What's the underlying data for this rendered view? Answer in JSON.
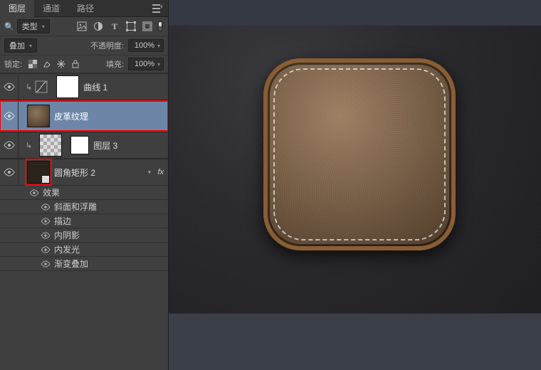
{
  "tabs": {
    "layers": "图层",
    "channels": "通道",
    "paths": "路径"
  },
  "filter_row": {
    "kind_label": "类型",
    "icons": [
      "image-filter-icon",
      "adjust-filter-icon",
      "type-filter-icon",
      "shape-filter-icon",
      "smart-filter-icon"
    ]
  },
  "blend_row": {
    "mode": "叠加",
    "opacity_label": "不透明度:",
    "opacity_value": "100%"
  },
  "lock_row": {
    "lock_label": "锁定:",
    "fill_label": "填充:",
    "fill_value": "100%"
  },
  "layers": [
    {
      "id": "curves",
      "name": "曲线 1",
      "kind": "adjustment"
    },
    {
      "id": "leather",
      "name": "皮革纹理",
      "kind": "raster",
      "selected": true,
      "highlight": true
    },
    {
      "id": "layer3",
      "name": "图层 3",
      "kind": "clipped-raster"
    },
    {
      "id": "rrect",
      "name": "圆角矩形 2",
      "kind": "shape",
      "highlight_thumb": true,
      "fx_badge": "fx",
      "effects_header": "效果",
      "effects": [
        "斜面和浮雕",
        "描边",
        "内阴影",
        "内发光",
        "渐变叠加"
      ]
    }
  ]
}
